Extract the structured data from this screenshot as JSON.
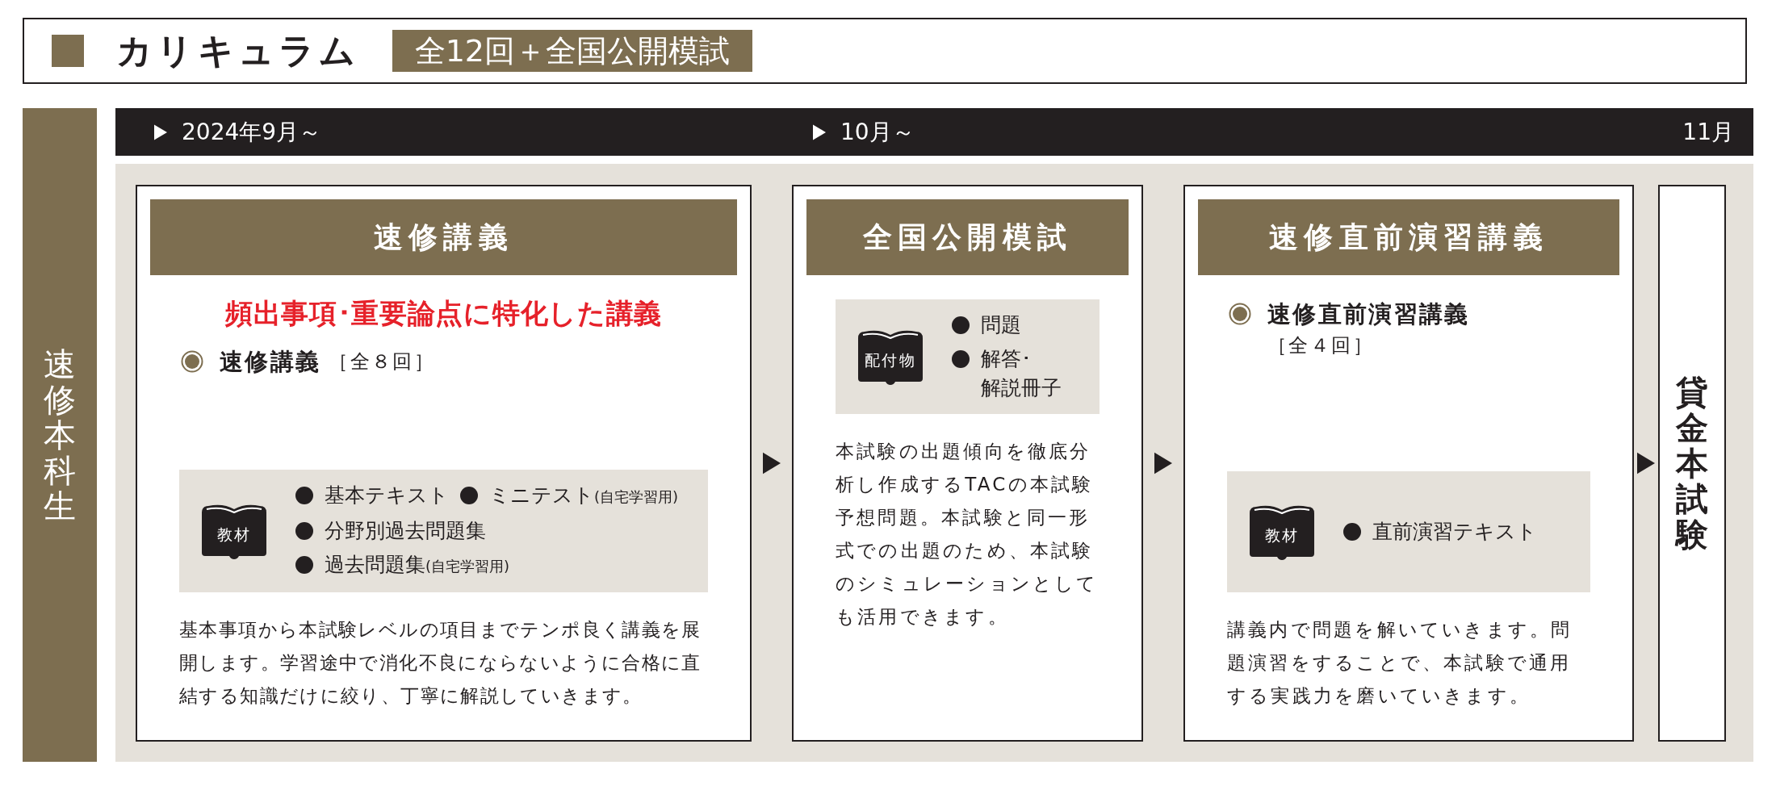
{
  "header": {
    "title": "カリキュラム",
    "badge": "全12回＋全国公開模試"
  },
  "course_label": "速修本科生",
  "timeline": [
    {
      "label": "2024年9月～",
      "arrow": true
    },
    {
      "label": "10月～",
      "arrow": true
    },
    {
      "label": "11月",
      "arrow": false
    }
  ],
  "stages": [
    {
      "title": "速修講義",
      "highlight": "頻出事項･重要論点に特化した講義",
      "course": {
        "name": "速修講義",
        "count": "［全８回］",
        "count_below": false
      },
      "materials": {
        "label": "教材",
        "lines": [
          [
            {
              "text": "基本テキスト"
            },
            {
              "text": "ミニテスト",
              "note": "(自宅学習用)"
            }
          ],
          [
            {
              "text": "分野別過去問題集"
            }
          ],
          [
            {
              "text": "過去問題集",
              "note": "(自宅学習用)"
            }
          ]
        ]
      },
      "description": "基本事項から本試験レベルの項目までテンポ良く講義を展開します。学習途中で消化不良にならないように合格に直結する知識だけに絞り、丁寧に解説していきます。"
    },
    {
      "title": "全国公開模試",
      "materials": {
        "label": "配付物",
        "lines": [
          [
            {
              "text": "問題"
            }
          ],
          [
            {
              "text": "解答･",
              "continuation": "解説冊子"
            }
          ]
        ]
      },
      "description": "本試験の出題傾向を徹底分析し作成するTACの本試験予想問題。本試験と同一形式での出題のため、本試験のシミュレーションとしても活用できます。"
    },
    {
      "title": "速修直前演習講義",
      "course": {
        "name": "速修直前演習講義",
        "count": "［全４回］",
        "count_below": true
      },
      "materials": {
        "label": "教材",
        "lines": [
          [
            {
              "text": "直前演習テキスト"
            }
          ]
        ]
      },
      "description": "講義内で問題を解いていきます。問題演習をすることで、本試験で通用する実践力を磨いていきます。"
    }
  ],
  "final": {
    "title": "貸金本試験"
  }
}
